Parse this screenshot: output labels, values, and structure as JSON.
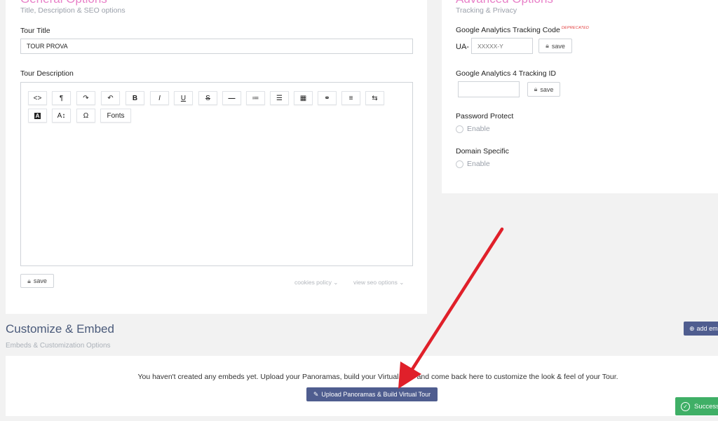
{
  "general": {
    "title": "General Options",
    "subtitle": "Title, Description & SEO options",
    "tour_title_label": "Tour Title",
    "tour_title_value": "TOUR PROVA",
    "tour_description_label": "Tour Description",
    "save_label": "save",
    "cookies_policy": "cookies policy ⌄",
    "view_seo_options": "view seo options ⌄"
  },
  "editor": {
    "toolbar_row1": [
      {
        "icon": "code-view-icon",
        "glyph": "<>"
      },
      {
        "icon": "paragraph-icon",
        "glyph": "¶"
      },
      {
        "icon": "redo-icon",
        "glyph": "↷"
      },
      {
        "icon": "undo-icon",
        "glyph": "↶"
      },
      {
        "icon": "bold-icon",
        "glyph": "B"
      },
      {
        "icon": "italic-icon",
        "glyph": "I"
      },
      {
        "icon": "underline-icon",
        "glyph": "U"
      },
      {
        "icon": "strikethrough-icon",
        "glyph": "S"
      },
      {
        "icon": "horizontal-rule-icon",
        "glyph": "—"
      },
      {
        "icon": "ordered-list-icon",
        "glyph": "≔"
      },
      {
        "icon": "unordered-list-icon",
        "glyph": "☰"
      },
      {
        "icon": "table-icon",
        "glyph": "▦"
      },
      {
        "icon": "link-icon",
        "glyph": "⚭"
      },
      {
        "icon": "align-icon",
        "glyph": "≡"
      },
      {
        "icon": "line-height-icon",
        "glyph": "⇆"
      }
    ],
    "toolbar_row2": [
      {
        "icon": "text-color-icon",
        "glyph": "A"
      },
      {
        "icon": "font-size-icon",
        "glyph": "A↕"
      },
      {
        "icon": "special-characters-icon",
        "glyph": "Ω"
      },
      {
        "icon": "fonts-button",
        "glyph": "Fonts"
      }
    ]
  },
  "advanced": {
    "title": "Advanced Options",
    "subtitle": "Tracking & Privacy",
    "ga_label": "Google Analytics Tracking Code",
    "deprecated_badge": "DEPRECATED",
    "ga_prefix": "UA-",
    "ga_placeholder": "XXXXX-Y",
    "ga4_label": "Google Analytics 4 Tracking ID",
    "save_label": "save",
    "password_label": "Password Protect",
    "password_option": "Enable",
    "domain_label": "Domain Specific",
    "domain_option": "Enable"
  },
  "embed": {
    "title": "Customize & Embed",
    "subtitle": "Embeds & Customization Options",
    "add_button": "add em",
    "message": "You haven't created any embeds yet. Upload your Panoramas, build your Virtual Tour and come back here to customize the look & feel of your Tour.",
    "upload_button": "Upload Panoramas & Build Virtual Tour"
  },
  "toast": {
    "text": "Success"
  },
  "colors": {
    "accent_pink": "#e880c8",
    "button_blue": "#4f5d8f",
    "success_green": "#3faf66",
    "arrow_red": "#e0202a"
  }
}
